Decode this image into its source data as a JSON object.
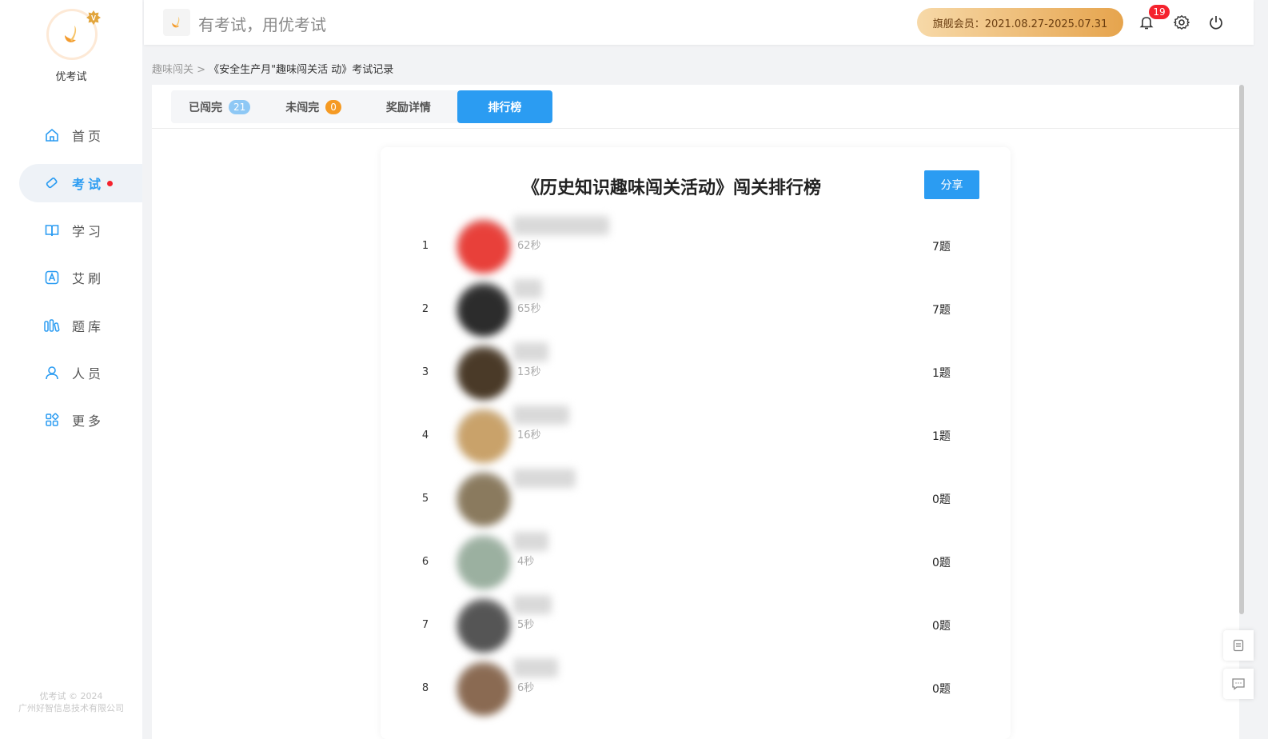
{
  "app": {
    "name": "优考试",
    "slogan": "有考试，用优考试"
  },
  "sidebar": {
    "items": [
      {
        "label": "首页",
        "icon": "home-icon"
      },
      {
        "label": "考试",
        "icon": "eraser-icon",
        "active": true,
        "dot": true
      },
      {
        "label": "学习",
        "icon": "book-icon"
      },
      {
        "label": "艾刷",
        "icon": "letter-a-icon"
      },
      {
        "label": "题库",
        "icon": "library-icon"
      },
      {
        "label": "人员",
        "icon": "user-icon"
      },
      {
        "label": "更多",
        "icon": "grid-icon"
      }
    ],
    "footer": [
      "优考试 © 2024",
      "广州好智信息技术有限公司"
    ]
  },
  "header": {
    "member": "旗舰会员：2021.08.27-2025.07.31",
    "notifications": "19"
  },
  "breadcrumb": {
    "parent": "趣味闯关 >",
    "current": "《安全生产月\"趣味闯关活 动》考试记录"
  },
  "tabs": [
    {
      "label": "已闯完",
      "count": "21",
      "count_color": "#8ec8f5"
    },
    {
      "label": "未闯完",
      "count": "0",
      "count_color": "#f59a23"
    },
    {
      "label": "奖励详情",
      "count": ""
    },
    {
      "label": "排行榜",
      "count": "",
      "active": true
    }
  ],
  "board": {
    "title": "《历史知识趣味闯关活动》闯关排行榜",
    "share": "分享",
    "rows": [
      {
        "rank": "1",
        "time": "62秒",
        "score": "7题",
        "avatar_color": "#e8403a",
        "name_w": 120
      },
      {
        "rank": "2",
        "time": "65秒",
        "score": "7题",
        "avatar_color": "#2c2c2c",
        "name_w": 36
      },
      {
        "rank": "3",
        "time": "13秒",
        "score": "1题",
        "avatar_color": "#4a3a28",
        "name_w": 44
      },
      {
        "rank": "4",
        "time": "16秒",
        "score": "1题",
        "avatar_color": "#c9a26a",
        "name_w": 70
      },
      {
        "rank": "5",
        "time": "",
        "score": "0题",
        "avatar_color": "#8a7a5e",
        "name_w": 78
      },
      {
        "rank": "6",
        "time": "4秒",
        "score": "0题",
        "avatar_color": "#9bb0a0",
        "name_w": 44
      },
      {
        "rank": "7",
        "time": "5秒",
        "score": "0题",
        "avatar_color": "#555555",
        "name_w": 48
      },
      {
        "rank": "8",
        "time": "6秒",
        "score": "0题",
        "avatar_color": "#8a6a52",
        "name_w": 56
      }
    ]
  },
  "colors": {
    "accent": "#2b9cf2",
    "danger": "#f5222d"
  }
}
